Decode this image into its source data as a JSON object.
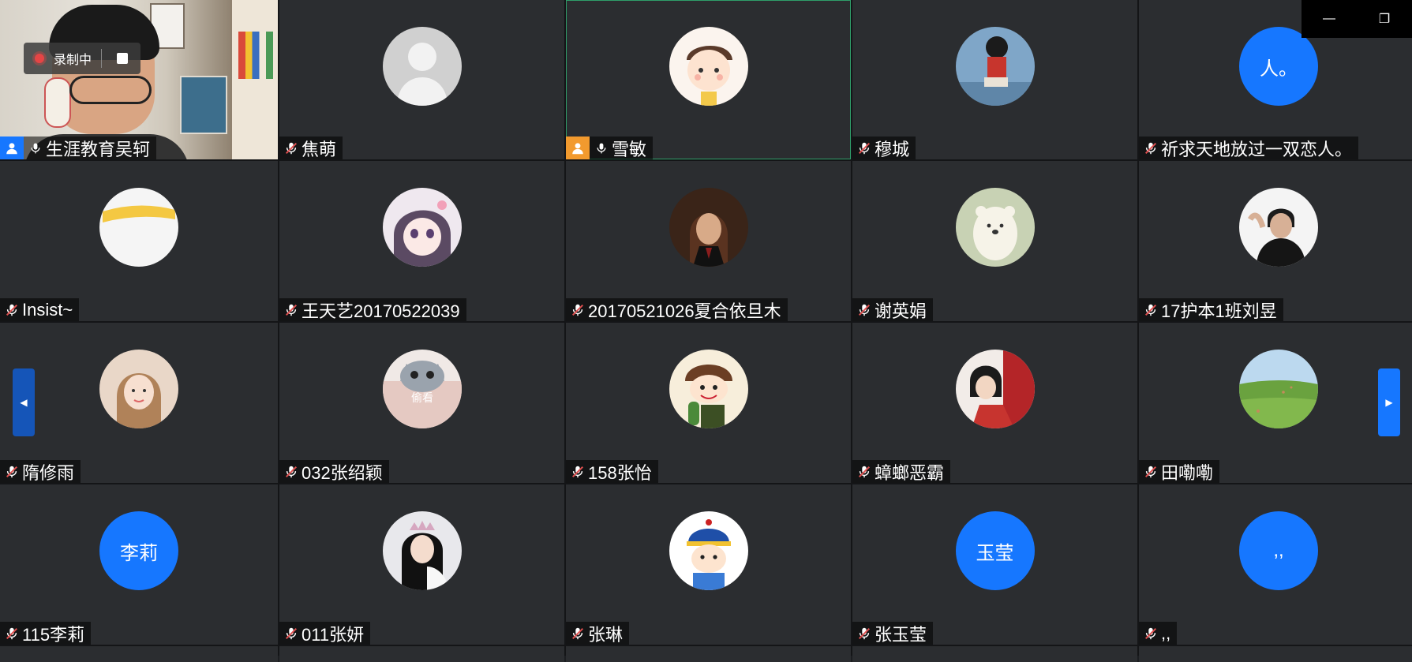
{
  "recording": {
    "label": "录制中"
  },
  "window_controls": {
    "minimize": "—",
    "restore": "❐"
  },
  "arrows": {
    "prev": "◀",
    "next": "▶"
  },
  "colors": {
    "accent": "#1677ff",
    "host_orange": "#f29a2e",
    "speaking_border": "#2f9e6a",
    "muted_icon": "#e05050"
  },
  "participants": [
    {
      "name": "生涯教育吴轲",
      "avatar_text": "",
      "avatar_type": "video",
      "mic": "on",
      "badge": "blue"
    },
    {
      "name": "焦萌",
      "avatar_text": "",
      "avatar_type": "default-person",
      "mic": "muted",
      "badge": ""
    },
    {
      "name": "雪敏",
      "avatar_text": "",
      "avatar_type": "cartoon-boy",
      "mic": "on",
      "badge": "orange",
      "speaking": true
    },
    {
      "name": "穆城",
      "avatar_text": "",
      "avatar_type": "photo-figure",
      "mic": "muted",
      "badge": ""
    },
    {
      "name": "祈求天地放过一双恋人。",
      "avatar_text": "人。",
      "avatar_type": "text",
      "mic": "muted",
      "badge": ""
    },
    {
      "name": "Insist~",
      "avatar_text": "",
      "avatar_type": "yellow-brush",
      "mic": "muted",
      "badge": ""
    },
    {
      "name": "王天艺20170522039",
      "avatar_text": "",
      "avatar_type": "anime-girl",
      "mic": "muted",
      "badge": ""
    },
    {
      "name": "20170521026夏合依旦木",
      "avatar_text": "",
      "avatar_type": "photo-dark",
      "mic": "muted",
      "badge": ""
    },
    {
      "name": "谢英娟",
      "avatar_text": "",
      "avatar_type": "polar-bear",
      "mic": "muted",
      "badge": ""
    },
    {
      "name": "17护本1班刘昱",
      "avatar_text": "",
      "avatar_type": "photo-man",
      "mic": "muted",
      "badge": ""
    },
    {
      "name": "隋修雨",
      "avatar_text": "",
      "avatar_type": "photo-girl",
      "mic": "muted",
      "badge": ""
    },
    {
      "name": "032张绍颖",
      "avatar_text": "偷看",
      "avatar_type": "cat",
      "mic": "muted",
      "badge": ""
    },
    {
      "name": "158张怡",
      "avatar_text": "",
      "avatar_type": "cartoon-cactus",
      "mic": "muted",
      "badge": ""
    },
    {
      "name": "蟑螂恶霸",
      "avatar_text": "",
      "avatar_type": "photo-red",
      "mic": "muted",
      "badge": ""
    },
    {
      "name": "田嘞嘞",
      "avatar_text": "",
      "avatar_type": "landscape",
      "mic": "muted",
      "badge": ""
    },
    {
      "name": "115李莉",
      "avatar_text": "李莉",
      "avatar_type": "text",
      "mic": "muted",
      "badge": ""
    },
    {
      "name": "011张妍",
      "avatar_text": "",
      "avatar_type": "photo-queen",
      "mic": "muted",
      "badge": ""
    },
    {
      "name": "张琳",
      "avatar_text": "",
      "avatar_type": "cartoon-qing",
      "mic": "muted",
      "badge": ""
    },
    {
      "name": "张玉莹",
      "avatar_text": "玉莹",
      "avatar_type": "text",
      "mic": "muted",
      "badge": ""
    },
    {
      "name": ",,",
      "avatar_text": ",,",
      "avatar_type": "text",
      "mic": "muted",
      "badge": ""
    }
  ]
}
